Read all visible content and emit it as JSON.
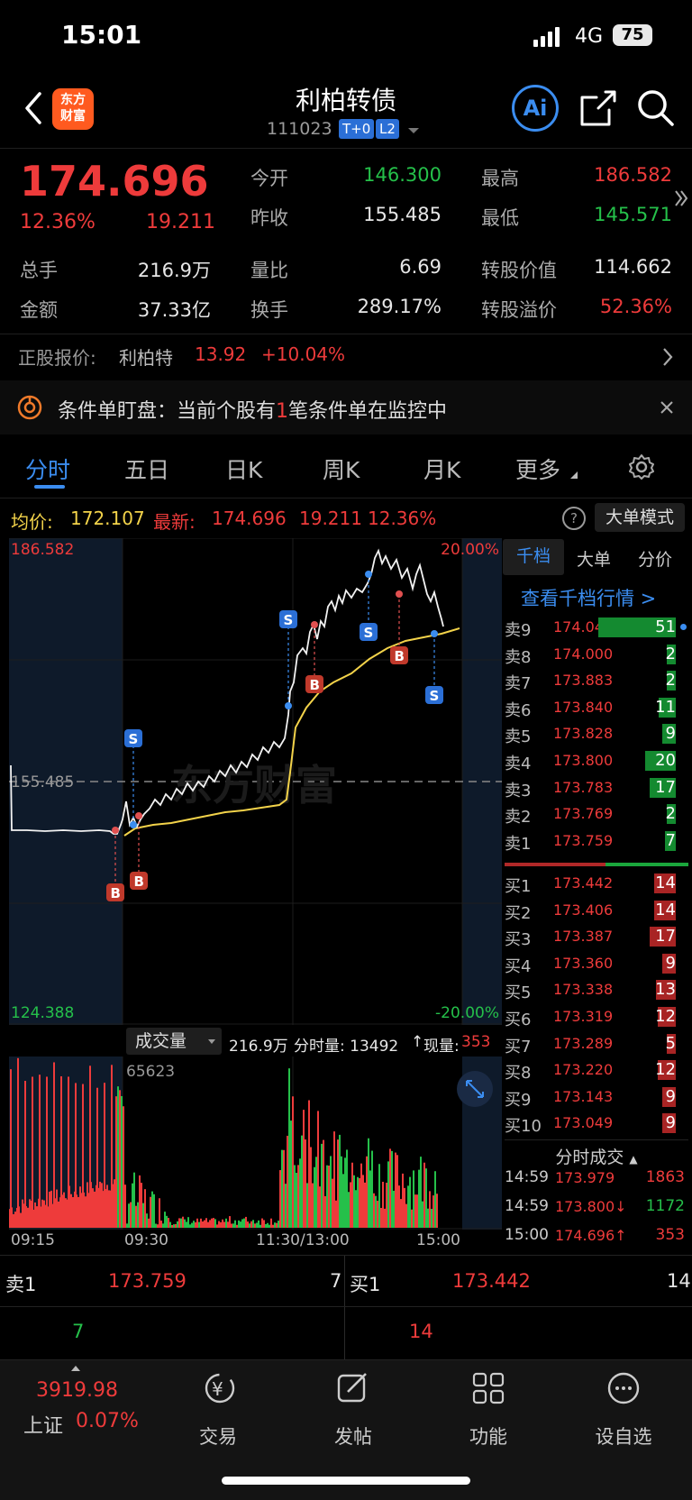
{
  "status_bar": {
    "time": "15:01",
    "network": "4G",
    "battery": "75"
  },
  "header": {
    "title": "利柏转债",
    "code": "111023",
    "tag1": "T+0",
    "tag2": "L2",
    "logo": "东方\n财富",
    "ai_label": "Ai"
  },
  "quote": {
    "price": "174.696",
    "change_pct": "12.36%",
    "change": "19.211",
    "open_label": "今开",
    "open": "146.300",
    "high_label": "最高",
    "high": "186.582",
    "prev_label": "昨收",
    "prev": "155.485",
    "low_label": "最低",
    "low": "145.571",
    "vol_label": "总手",
    "vol": "216.9万",
    "ratio_label": "量比",
    "ratio": "6.69",
    "conv_value_label": "转股价值",
    "conv_value": "114.662",
    "amount_label": "金额",
    "amount": "37.33亿",
    "turnover_label": "换手",
    "turnover": "289.17%",
    "premium_label": "转股溢价",
    "premium": "52.36%"
  },
  "stock_row": {
    "label": "正股报价:",
    "name": "利柏特",
    "price": "13.92",
    "change": "+10.04%"
  },
  "notice": {
    "text_a": "条件单盯盘：当前个股有",
    "count": "1",
    "text_b": "笔条件单在监控中"
  },
  "tabs": [
    "分时",
    "五日",
    "日K",
    "周K",
    "月K",
    "更多"
  ],
  "info_line": {
    "avg_label": "均价:",
    "avg": "172.107",
    "latest_label": "最新:",
    "latest": "174.696",
    "chg": "19.211",
    "pct": "12.36%",
    "mode_button": "大单模式"
  },
  "chart_labels": {
    "top_price": "186.582",
    "mid_price": "155.485",
    "bottom_price": "124.388",
    "top_pct": "20.00%",
    "bottom_pct": "-20.00%",
    "watermark": "东方财富"
  },
  "volume_bar": {
    "selector": "成交量",
    "total": "216.9万",
    "tick_label": "分时量: 13492",
    "now_label": "现量:",
    "now": "353",
    "max": "65623"
  },
  "time_axis": [
    "09:15",
    "09:30",
    "11:30/13:00",
    "15:00"
  ],
  "side_tabs": [
    "千档",
    "大单",
    "分价"
  ],
  "side_link": "查看千档行情 >",
  "asks": [
    {
      "name": "卖9",
      "price": "174.044",
      "qty": "51"
    },
    {
      "name": "卖8",
      "price": "174.000",
      "qty": "2"
    },
    {
      "name": "卖7",
      "price": "173.883",
      "qty": "2"
    },
    {
      "name": "卖6",
      "price": "173.840",
      "qty": "11"
    },
    {
      "name": "卖5",
      "price": "173.828",
      "qty": "9"
    },
    {
      "name": "卖4",
      "price": "173.800",
      "qty": "20"
    },
    {
      "name": "卖3",
      "price": "173.783",
      "qty": "17"
    },
    {
      "name": "卖2",
      "price": "173.769",
      "qty": "2"
    },
    {
      "name": "卖1",
      "price": "173.759",
      "qty": "7"
    }
  ],
  "bids": [
    {
      "name": "买1",
      "price": "173.442",
      "qty": "14"
    },
    {
      "name": "买2",
      "price": "173.406",
      "qty": "14"
    },
    {
      "name": "买3",
      "price": "173.387",
      "qty": "17"
    },
    {
      "name": "买4",
      "price": "173.360",
      "qty": "9"
    },
    {
      "name": "买5",
      "price": "173.338",
      "qty": "13"
    },
    {
      "name": "买6",
      "price": "173.319",
      "qty": "12"
    },
    {
      "name": "买7",
      "price": "173.289",
      "qty": "5"
    },
    {
      "name": "买8",
      "price": "173.220",
      "qty": "12"
    },
    {
      "name": "买9",
      "price": "173.143",
      "qty": "9"
    },
    {
      "name": "买10",
      "price": "173.049",
      "qty": "9"
    }
  ],
  "ticks_header": "分时成交",
  "ticks": [
    {
      "time": "14:59",
      "price": "173.979",
      "qty": "1863"
    },
    {
      "time": "14:59",
      "price": "173.800↓",
      "qty": "1172"
    },
    {
      "time": "15:00",
      "price": "174.696↑",
      "qty": "353"
    }
  ],
  "level1": {
    "ask_label": "卖1",
    "ask_price": "173.759",
    "ask_qty": "7",
    "bid_label": "买1",
    "bid_price": "173.442",
    "bid_qty": "14",
    "ask_qty2": "7",
    "bid_qty2": "14"
  },
  "bottom_nav": {
    "index_value": "3919.98",
    "index_name": "上证",
    "index_change": "0.07%",
    "items": [
      "交易",
      "发帖",
      "功能",
      "设自选"
    ]
  },
  "colors": {
    "up": "#ee3b3b",
    "down": "#25c04a",
    "accent": "#3b8df0",
    "avg_line": "#f3d34a"
  }
}
